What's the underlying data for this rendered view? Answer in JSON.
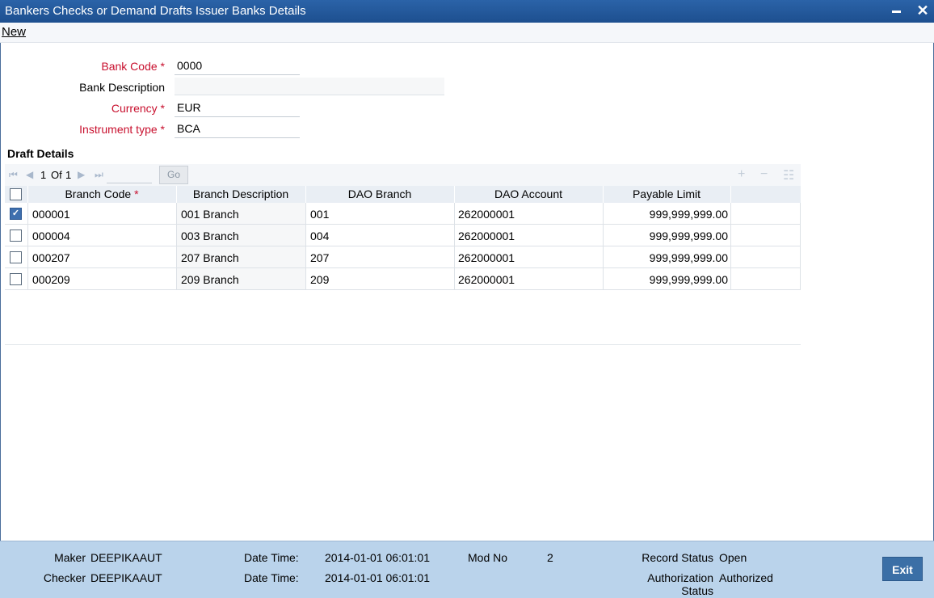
{
  "window": {
    "title": "Bankers Checks or Demand Drafts Issuer Banks Details",
    "minimize_icon": "minimize-icon",
    "close_glyph": "✕"
  },
  "menu": {
    "new_label": "New"
  },
  "form": {
    "bank_code": {
      "label": "Bank Code",
      "required": "*",
      "value": "0000"
    },
    "bank_description": {
      "label": "Bank Description",
      "value": ""
    },
    "currency": {
      "label": "Currency",
      "required": "*",
      "value": "EUR"
    },
    "instrument_type": {
      "label": "Instrument type",
      "required": "*",
      "value": "BCA"
    }
  },
  "draft_details": {
    "title": "Draft Details",
    "pager": {
      "current": "1",
      "of_label": "Of",
      "total": "1",
      "go_label": "Go"
    },
    "columns": {
      "branch_code": "Branch Code",
      "branch_code_required": "*",
      "branch_description": "Branch Description",
      "dao_branch": "DAO Branch",
      "dao_account": "DAO Account",
      "payable_limit": "Payable Limit"
    },
    "rows": [
      {
        "checked": true,
        "branch_code": "000001",
        "branch_description": "001 Branch",
        "dao_branch": "001",
        "dao_account": "262000001",
        "payable_limit": "999,999,999.00"
      },
      {
        "checked": false,
        "branch_code": "000004",
        "branch_description": "003 Branch",
        "dao_branch": "004",
        "dao_account": "262000001",
        "payable_limit": "999,999,999.00"
      },
      {
        "checked": false,
        "branch_code": "000207",
        "branch_description": "207 Branch",
        "dao_branch": "207",
        "dao_account": "262000001",
        "payable_limit": "999,999,999.00"
      },
      {
        "checked": false,
        "branch_code": "000209",
        "branch_description": "209 Branch",
        "dao_branch": "209",
        "dao_account": "262000001",
        "payable_limit": "999,999,999.00"
      }
    ]
  },
  "footer": {
    "maker_label": "Maker",
    "maker_value": "DEEPIKAAUT",
    "checker_label": "Checker",
    "checker_value": "DEEPIKAAUT",
    "date_time_label": "Date Time:",
    "maker_date_time": "2014-01-01 06:01:01",
    "checker_date_time": "2014-01-01 06:01:01",
    "mod_no_label": "Mod No",
    "mod_no_value": "2",
    "record_status_label": "Record Status",
    "record_status_value": "Open",
    "authorization_status_label_1": "Authorization",
    "authorization_status_label_2": "Status",
    "authorization_status_value": "Authorized",
    "exit_label": "Exit"
  }
}
